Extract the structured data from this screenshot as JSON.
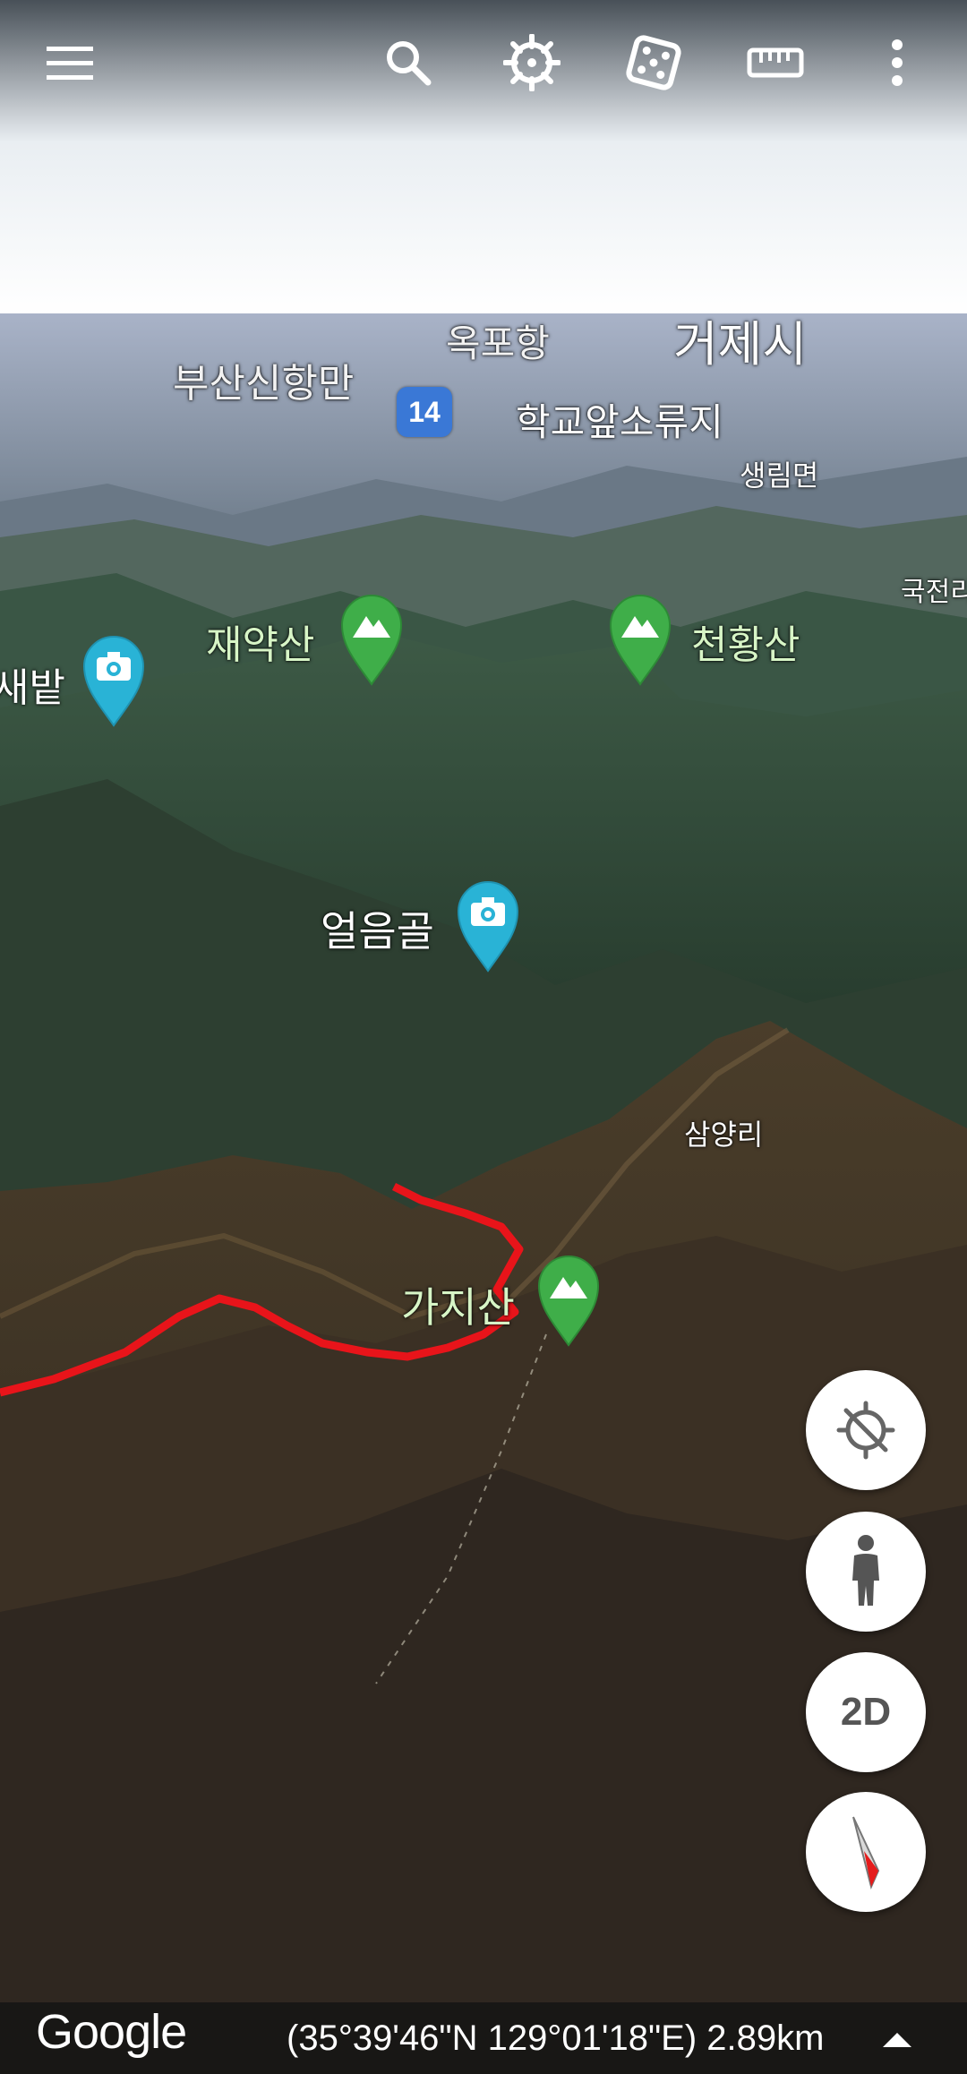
{
  "toolbar": {
    "icons": [
      "menu-icon",
      "search-icon",
      "voyager-icon",
      "feeling-lucky-icon",
      "measure-icon",
      "more-options-icon"
    ]
  },
  "map_labels": {
    "okpohang": "옥포항",
    "geojesi": "거제시",
    "busan_sinhangman": "부산신항만",
    "route_number": "14",
    "hakgyoap_soryuji": "학교앞소류지",
    "saengnimmyeon": "생림면",
    "gukjeon": "국전리",
    "jaeyaksan": "재약산",
    "cheonhwangsan": "천황산",
    "saebat": "새밭",
    "eoreumgol": "얼음골",
    "samyangri": "삼양리",
    "gajisan": "가지산"
  },
  "controls": {
    "mode_2d_label": "2D",
    "icons": [
      "location-off-icon",
      "pegman-icon",
      "compass-icon"
    ]
  },
  "footer": {
    "logo": "Google",
    "coordinates": "(35°39'46\"N 129°01'18\"E) 2.89km"
  },
  "colors": {
    "route_line": "#e8141a",
    "peak_pin": "#3fae49",
    "photo_pin": "#29b3d6",
    "route_shield": "#3a78d6"
  }
}
